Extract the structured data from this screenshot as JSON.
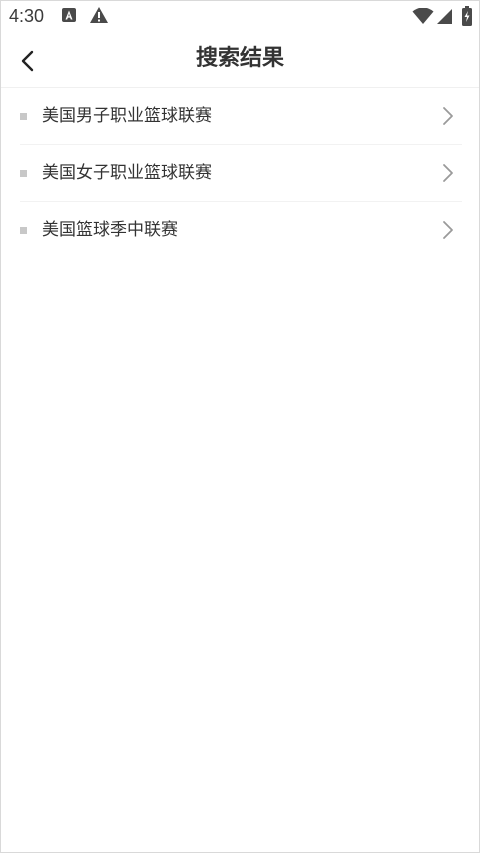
{
  "status_bar": {
    "time": "4:30",
    "icons": [
      "notification-a-icon",
      "warning-icon",
      "wifi-icon",
      "signal-icon",
      "battery-charging-icon"
    ]
  },
  "header": {
    "back_icon": "chevron-left-icon",
    "title": "搜索结果"
  },
  "results": [
    {
      "label": "美国男子职业篮球联赛"
    },
    {
      "label": "美国女子职业篮球联赛"
    },
    {
      "label": "美国篮球季中联赛"
    }
  ],
  "colors": {
    "text": "#333333",
    "bullet": "#c8c8c8",
    "chevron": "#9a9a9a",
    "divider": "#f2f2f2"
  }
}
